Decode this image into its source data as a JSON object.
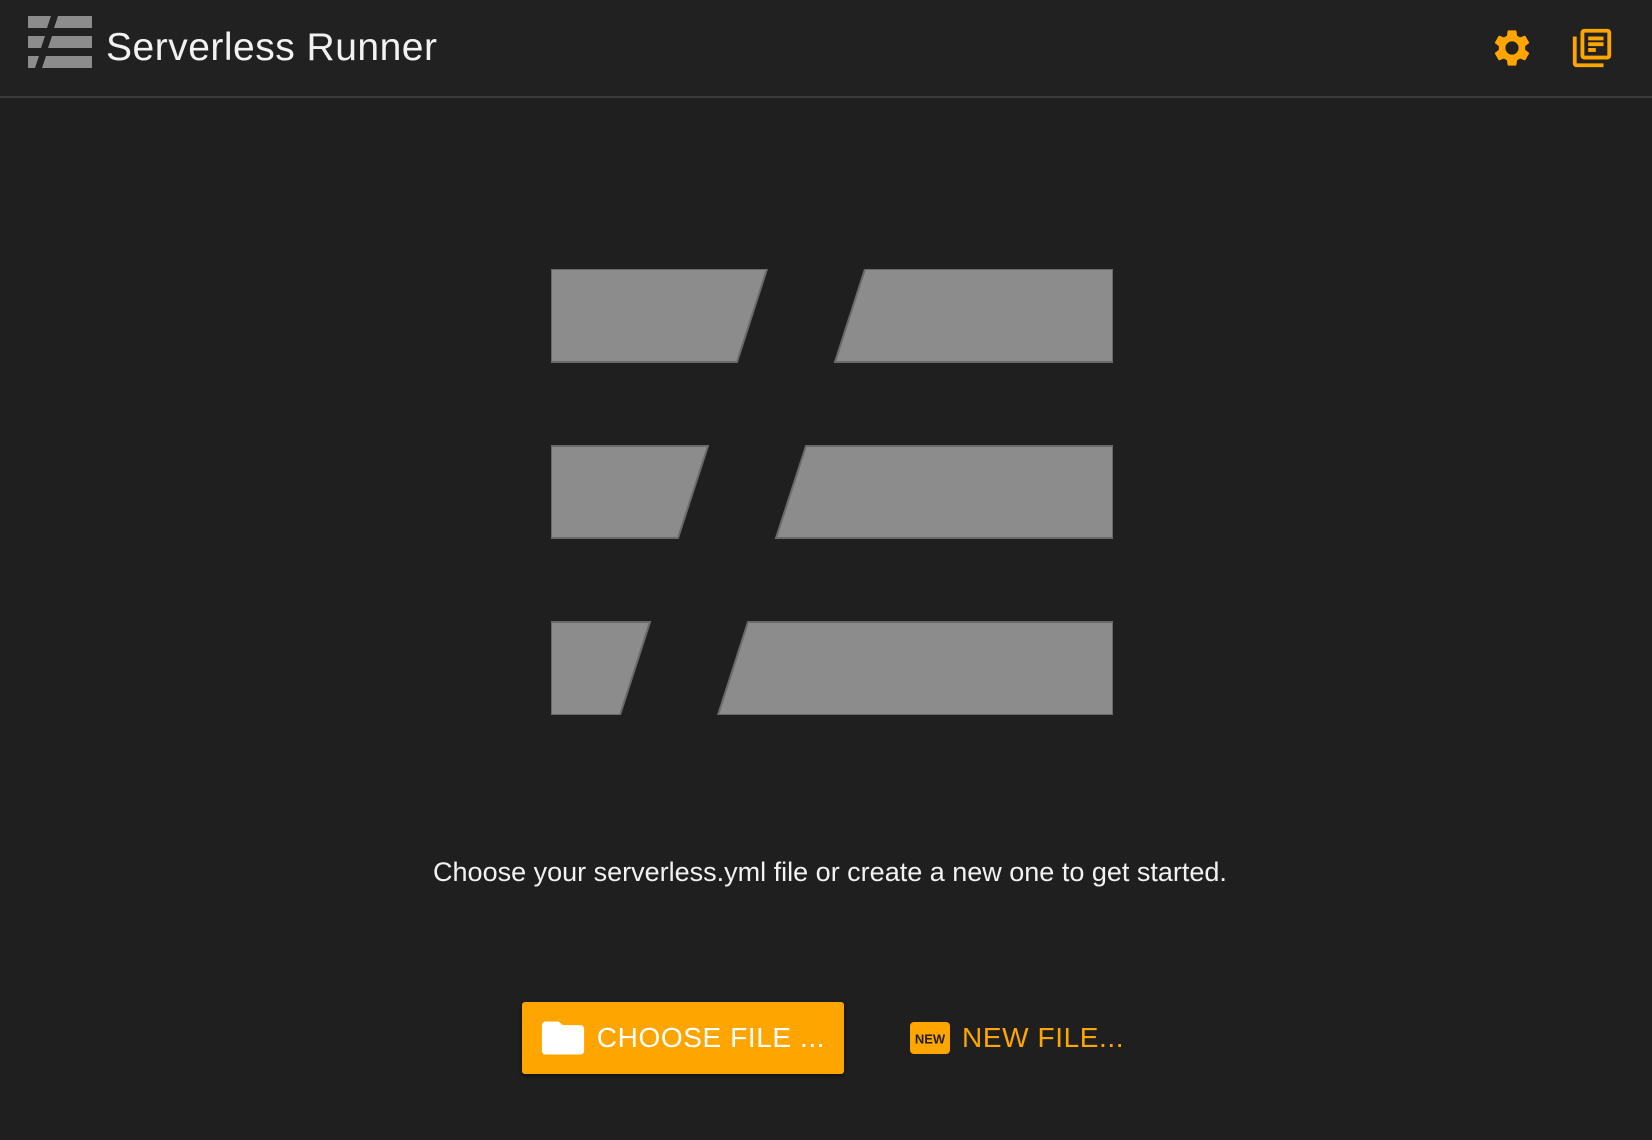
{
  "app": {
    "title": "Serverless Runner",
    "logo_icon": "serverless-logo-icon"
  },
  "toolbar": {
    "settings_icon": "gear-icon",
    "docs_icon": "library-books-icon"
  },
  "main": {
    "tagline": "Choose your serverless.yml file or create a new one to get started.",
    "choose_button_label": "CHOOSE FILE ...",
    "choose_button_icon": "folder-icon",
    "new_button_label": "NEW FILE...",
    "new_button_icon": "new-badge-icon",
    "new_badge_text": "NEW"
  },
  "colors": {
    "accent": "#ffa500",
    "background": "#1f1f1f",
    "logo_gray": "#8c8c8c",
    "text": "#f2f2f2"
  }
}
